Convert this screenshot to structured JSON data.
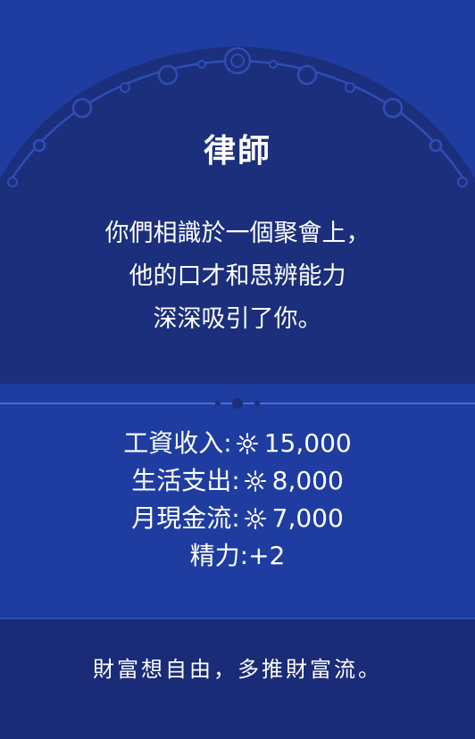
{
  "card": {
    "title": "律師",
    "description": [
      "你們相識於一個聚會上，",
      "他的口才和思辨能力",
      "深深吸引了你。"
    ],
    "stats": [
      {
        "label": "工資收入:",
        "value": "15,000",
        "icon": "sun-coin-icon"
      },
      {
        "label": "生活支出:",
        "value": "8,000",
        "icon": "sun-coin-icon"
      },
      {
        "label": "月現金流:",
        "value": "7,000",
        "icon": "sun-coin-icon"
      },
      {
        "label": "精力:",
        "value": "+2"
      }
    ],
    "slogan": "財富想自由，多推財富流。"
  },
  "colors": {
    "background": "#1f3da0",
    "arch": "#1c2f7c",
    "text": "#ffffff"
  }
}
